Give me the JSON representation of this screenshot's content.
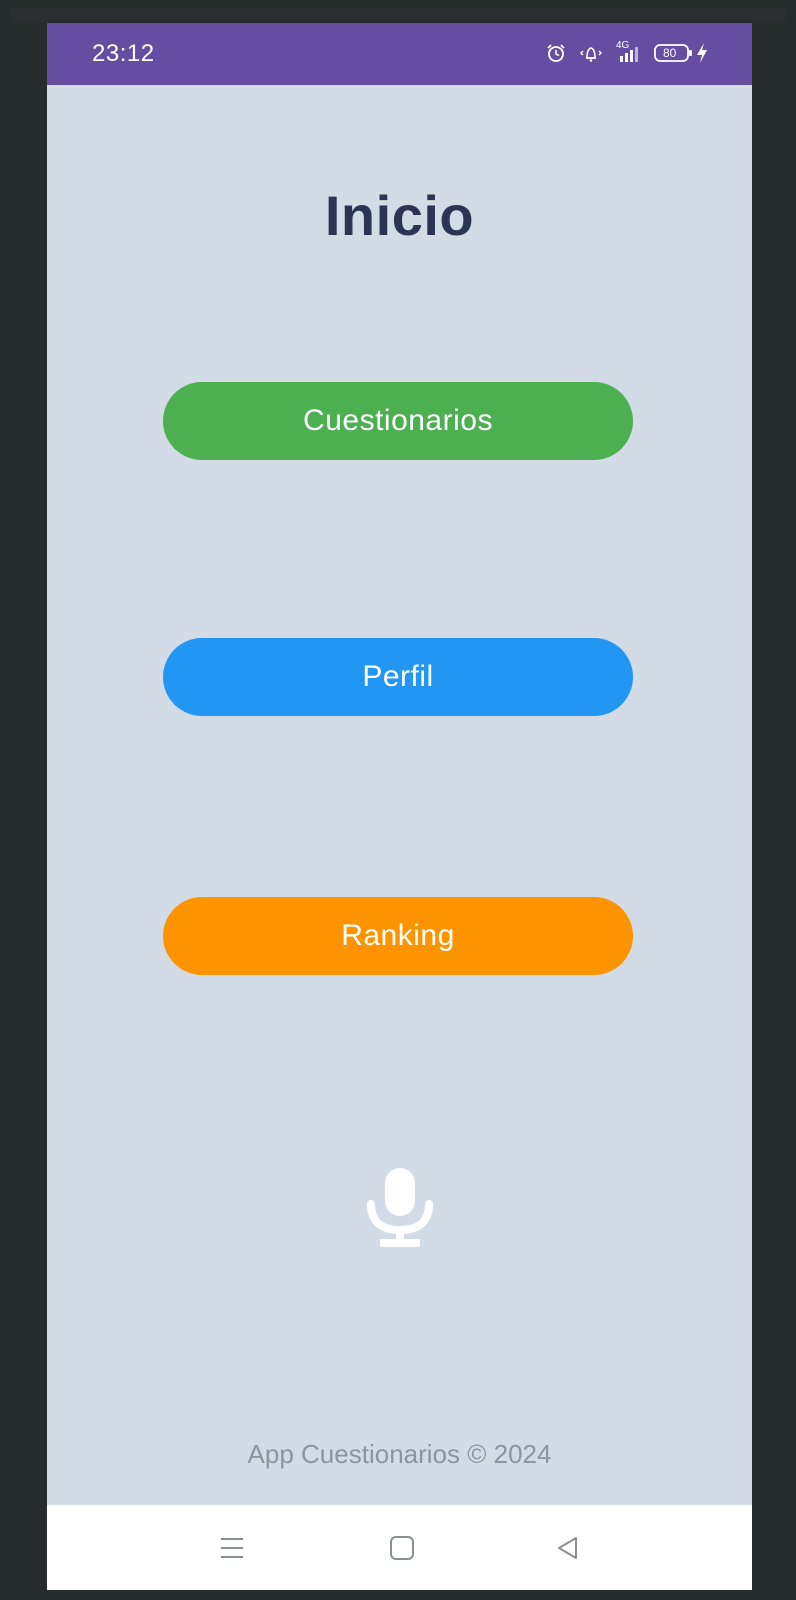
{
  "status_bar": {
    "time": "23:12",
    "network_label": "4G",
    "battery_level": "80",
    "icons": [
      "alarm-icon",
      "vibrate-icon",
      "signal-icon",
      "battery-icon",
      "charging-icon"
    ],
    "background_color": "#654da1"
  },
  "page": {
    "title": "Inicio",
    "background_color": "#d3dbe7"
  },
  "menu": {
    "questionnaires_label": "Cuestionarios",
    "profile_label": "Perfil",
    "ranking_label": "Ranking",
    "colors": {
      "questionnaires": "#4caf50",
      "profile": "#2196f3",
      "ranking": "#fb9400"
    }
  },
  "voice": {
    "icon": "microphone-icon"
  },
  "footer": {
    "text": "App Cuestionarios © 2024"
  },
  "system_nav": {
    "icons": [
      "menu-icon",
      "home-icon",
      "back-icon"
    ]
  }
}
